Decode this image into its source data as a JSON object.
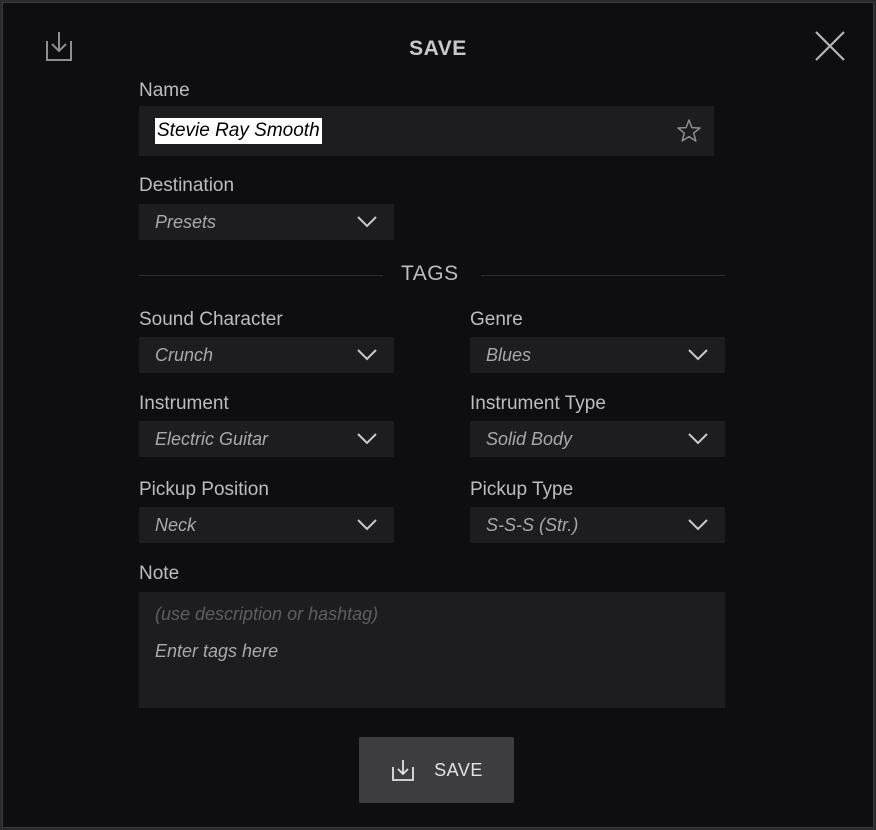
{
  "dialog": {
    "title": "SAVE",
    "import_icon": "import-download-icon",
    "close_icon": "close-icon"
  },
  "name": {
    "label": "Name",
    "value": "Stevie Ray Smooth",
    "favorite_icon": "star-outline-icon"
  },
  "destination": {
    "label": "Destination",
    "value": "Presets"
  },
  "tags": {
    "heading": "TAGS",
    "sound_character": {
      "label": "Sound Character",
      "value": "Crunch"
    },
    "genre": {
      "label": "Genre",
      "value": "Blues"
    },
    "instrument": {
      "label": "Instrument",
      "value": "Electric Guitar"
    },
    "instrument_type": {
      "label": "Instrument Type",
      "value": "Solid Body"
    },
    "pickup_position": {
      "label": "Pickup Position",
      "value": "Neck"
    },
    "pickup_type": {
      "label": "Pickup Type",
      "value": "S-S-S (Str.)"
    }
  },
  "note": {
    "label": "Note",
    "hint": "(use description or hashtag)",
    "placeholder": "Enter tags here"
  },
  "save_button": {
    "label": "SAVE",
    "icon": "save-download-icon"
  },
  "colors": {
    "background": "#0e0e10",
    "field": "#1d1d1f",
    "button": "#3d3d40"
  }
}
